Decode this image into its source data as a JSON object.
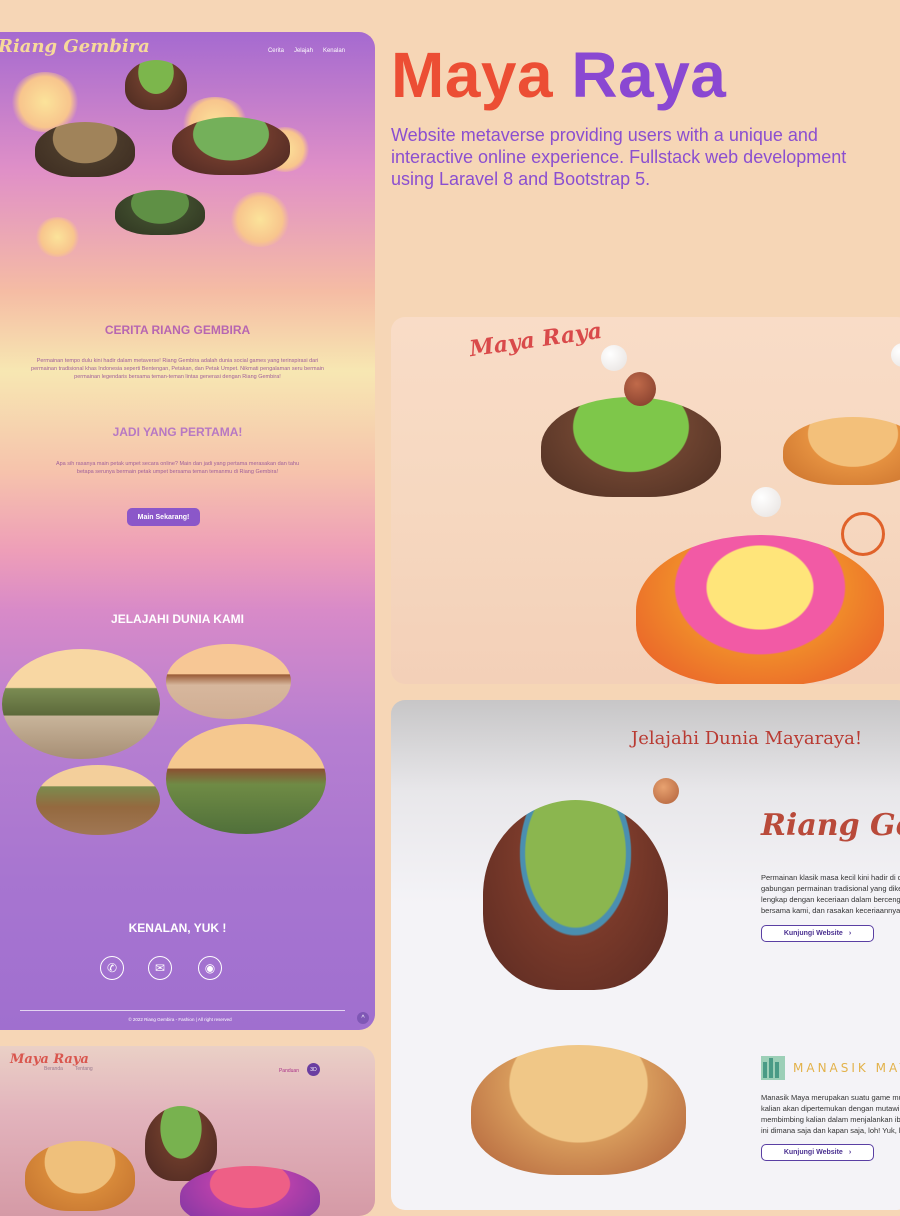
{
  "left_site": {
    "logo": "Riang Gembira",
    "nav": [
      "Cerita",
      "Jelajah",
      "Kenalan"
    ],
    "cerita_title": "CERITA RIANG GEMBIRA",
    "cerita_text": "Permainan tempo dulu kini hadir dalam metaverse! Riang Gembira adalah dunia social games yang terinspirasi dari permainan tradisional khas Indonesia seperti Bentengan, Petakan, dan Petak Umpet. Nikmati pengalaman seru bermain permainan legendaris bersama teman-teman lintas generasi dengan Riang Gembira!",
    "pertama_title": "JADI YANG PERTAMA!",
    "pertama_text": "Apa sih rasanya main petak umpet secara online? Main dan jadi yang pertama merasakan dan tahu betapa serunya bermain petak umpet bersama teman temanmu di Riang Gembira!",
    "play_button": "Main Sekarang!",
    "jelajahi_title": "JELAJAHI DUNIA KAMI",
    "kenalan_title": "KENALAN, YUK !",
    "social_icons": [
      "phone-icon",
      "mail-icon",
      "instagram-icon"
    ],
    "footer": "© 2022 Riang Gembira - Fashion | All right reserved",
    "back_to_top": "^"
  },
  "left_site2": {
    "logo": "Maya Raya",
    "nav": [
      "Beranda",
      "Tentang"
    ],
    "link": "Panduan",
    "button": "3D"
  },
  "project": {
    "title_word1": "Maya",
    "title_word2": "Raya",
    "description": "Website metaverse providing users with a unique and interactive online experience. Fullstack web development using Laravel 8 and Bootstrap 5."
  },
  "hero_preview": {
    "logo": "Maya Raya"
  },
  "explore_preview": {
    "title": "Jelajahi Dunia Mayaraya!",
    "item1": {
      "brand": "Riang Gembira",
      "text_lines": [
        "Permainan klasik masa kecil kini hadir di d",
        "gabungan permainan tradisional yang dike",
        "lengkap dengan keceriaan dalam bercengl",
        "bersama kami, dan rasakan keceriaannya!"
      ],
      "button": "Kunjungi Website"
    },
    "item2": {
      "brand": "MANASIK MAYA",
      "text_lines": [
        "Manasik Maya merupakan suatu game mu",
        "kalian akan dipertemukan dengan mutawi",
        "membimbing kalian dalam menjalankan ib",
        "ini dimana saja dan kapan saja, loh! Yuk, be"
      ],
      "button": "Kunjungi Website"
    }
  },
  "colors": {
    "background": "#f6d6b6",
    "title_orange": "#ec4e34",
    "title_purple": "#8a48d2",
    "button_purple": "#8b57c9"
  }
}
